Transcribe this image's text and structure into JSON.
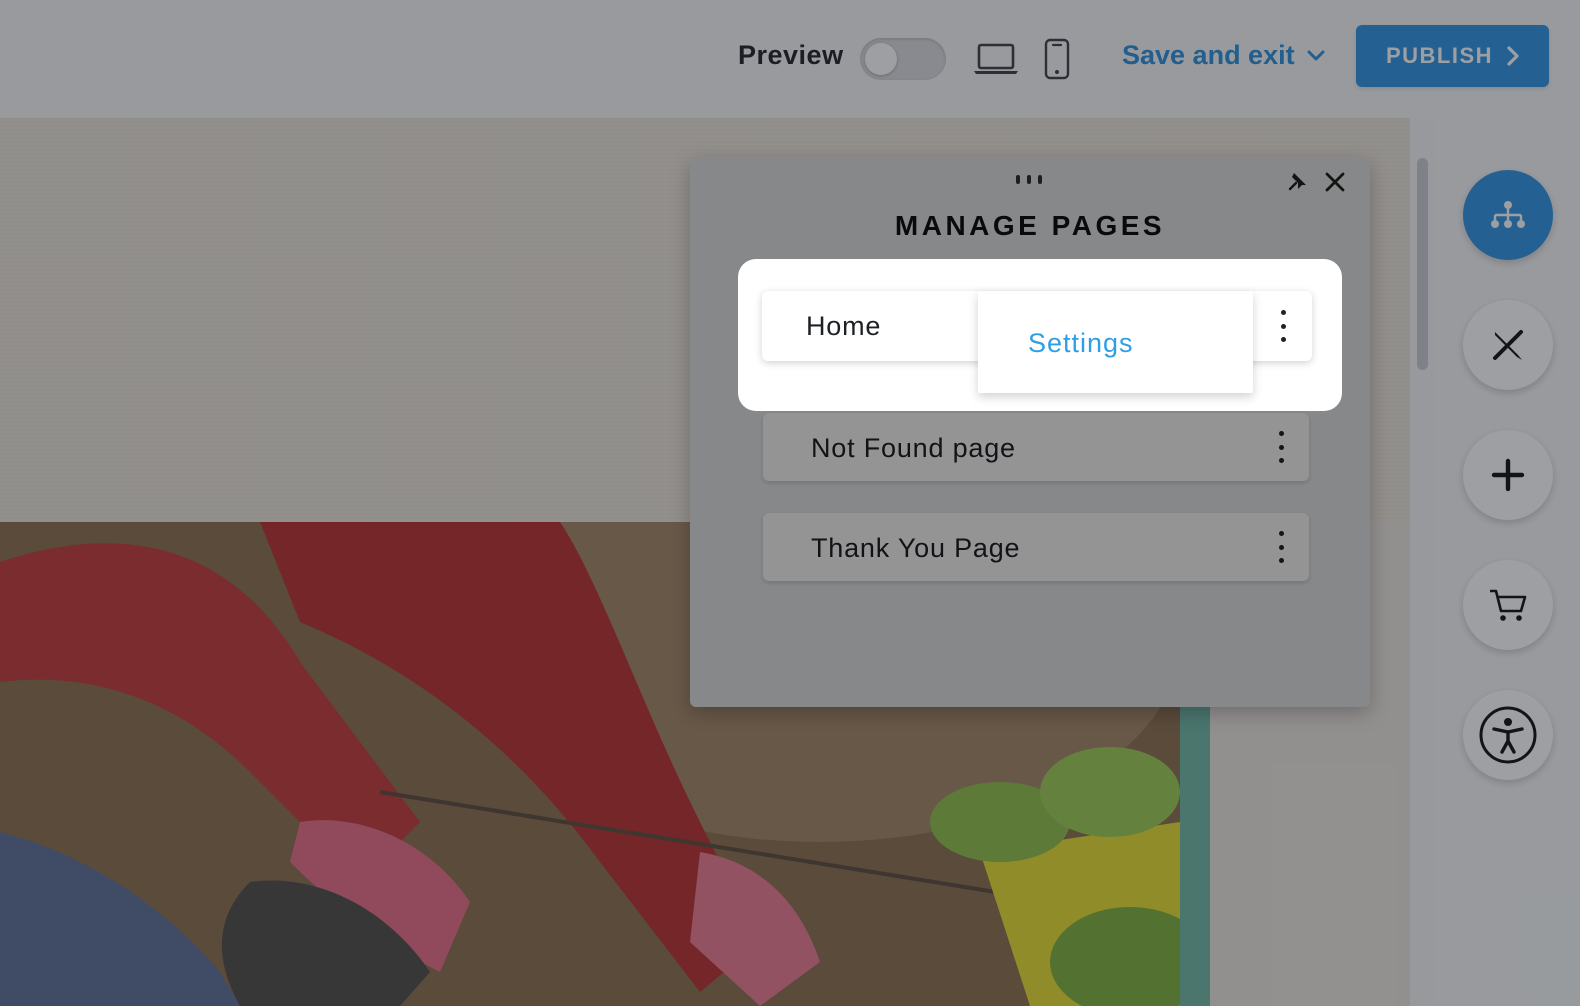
{
  "toolbar": {
    "preview_label": "Preview",
    "preview_enabled": false,
    "save_exit_label": "Save and exit",
    "publish_label": "PUBLISH",
    "devices": [
      "laptop-icon",
      "mobile-icon"
    ]
  },
  "modal": {
    "title": "MANAGE PAGES",
    "pages": [
      {
        "label": "Home"
      },
      {
        "label": "Not Found page"
      },
      {
        "label": "Thank You Page"
      }
    ],
    "context_menu": {
      "items": [
        {
          "label": "Settings"
        }
      ]
    }
  },
  "right_rail": {
    "buttons": [
      "sitemap-icon",
      "design-tools-icon",
      "plus-icon",
      "cart-icon",
      "accessibility-icon"
    ]
  },
  "colors": {
    "accent": "#2d94e3",
    "link": "#2e9fe6",
    "overlay": "rgba(23,27,33,0.42)"
  }
}
